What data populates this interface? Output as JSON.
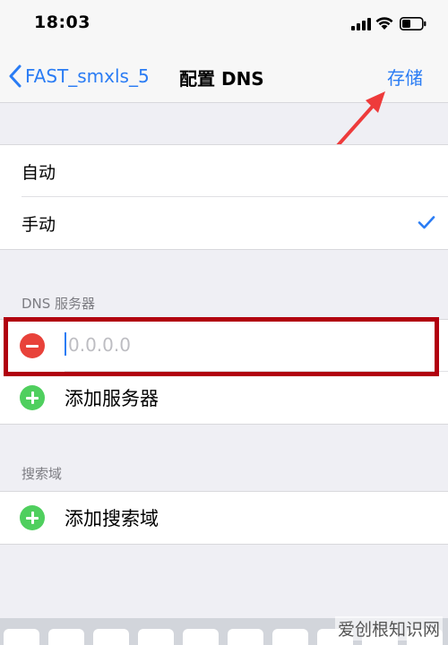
{
  "status_bar": {
    "time": "18:03"
  },
  "nav": {
    "back_label": "FAST_smxls_5",
    "title": "配置 DNS",
    "save_label": "存储"
  },
  "dns_mode": {
    "options": [
      {
        "label": "自动",
        "selected": false
      },
      {
        "label": "手动",
        "selected": true
      }
    ]
  },
  "dns_servers": {
    "header": "DNS 服务器",
    "entry_placeholder": "0.0.0.0",
    "entry_value": "",
    "add_label": "添加服务器"
  },
  "search_domains": {
    "header": "搜索域",
    "add_label": "添加搜索域"
  },
  "watermark": "爱创根知识网",
  "colors": {
    "accent": "#2a7cf4",
    "remove": "#e8423a",
    "add": "#4fcf5e",
    "highlight": "#b1000e"
  }
}
